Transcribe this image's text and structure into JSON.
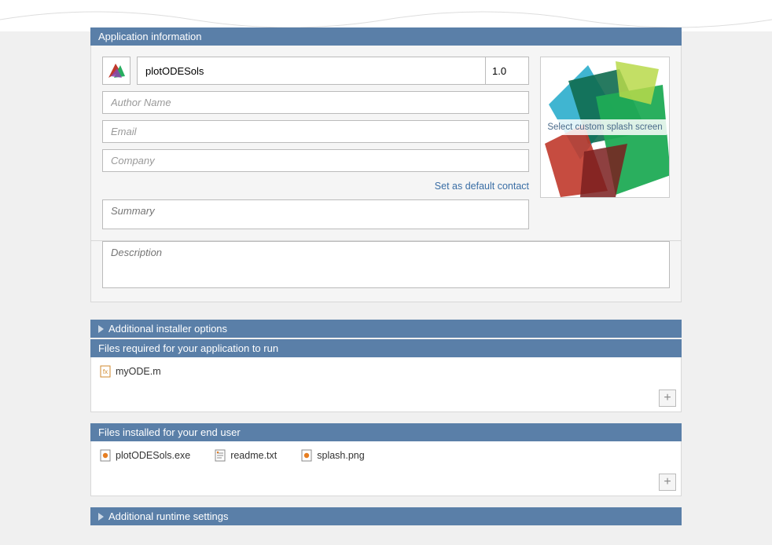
{
  "sections": {
    "app_info_title": "Application information",
    "additional_installer_title": "Additional installer options",
    "files_required_title": "Files required for your application to run",
    "files_installed_title": "Files installed for your end user",
    "additional_runtime_title": "Additional runtime settings"
  },
  "app_info": {
    "name": "plotODESols",
    "version": "1.0",
    "author_placeholder": "Author Name",
    "email_placeholder": "Email",
    "company_placeholder": "Company",
    "default_contact_link": "Set as default contact",
    "summary_placeholder": "Summary",
    "description_placeholder": "Description",
    "splash_label": "Select custom splash screen"
  },
  "files_required": [
    {
      "name": "myODE.m",
      "icon": "m-file"
    }
  ],
  "files_installed": [
    {
      "name": "plotODESols.exe",
      "icon": "exe-file"
    },
    {
      "name": "readme.txt",
      "icon": "txt-file"
    },
    {
      "name": "splash.png",
      "icon": "png-file"
    }
  ]
}
